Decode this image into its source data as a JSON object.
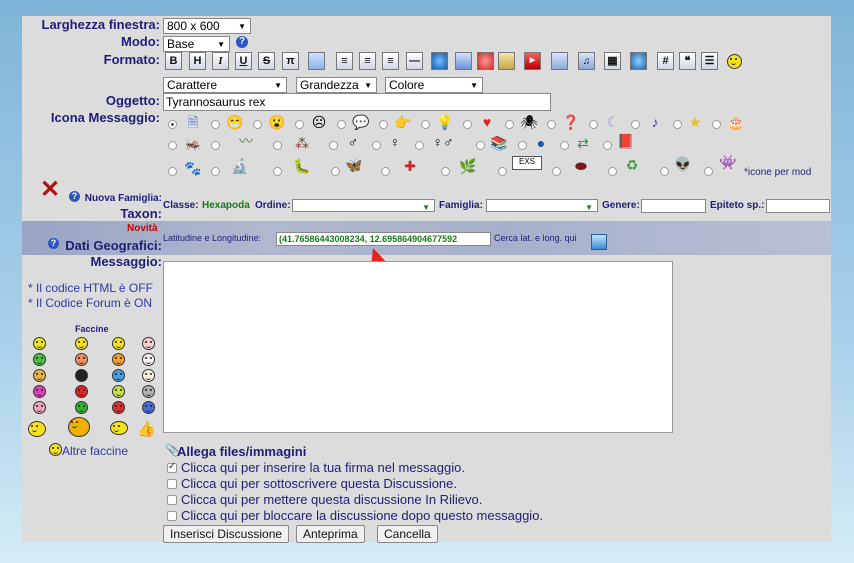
{
  "form": {
    "window_width_label": "Larghezza finestra:",
    "window_width_value": "800 x 600",
    "mode_label": "Modo:",
    "mode_value": "Base",
    "format_label": "Formato:",
    "font_select": "Carattere",
    "size_select": "Grandezza",
    "color_select": "Colore",
    "subject_label": "Oggetto:",
    "subject_value": "Tyrannosaurus rex",
    "icon_label": "Icona Messaggio:",
    "mod_icons_note": "icone per mod",
    "new_family_label": "Nuova Famiglia:",
    "taxon_label": "Taxon:",
    "class_label": "Classe:",
    "class_value": "Hexapoda",
    "order_label": "Ordine:",
    "family_label": "Famiglia:",
    "genus_label": "Genere:",
    "epithet_label": "Epiteto sp.:",
    "news_label": "Novità",
    "geo_label": "Dati Geografici:",
    "latlong_label": "Latitudine e Longitudine:",
    "latlong_value": "(41.76586443008234, 12.695864904677592",
    "latlong_search": "Cerca lat. e long. qui",
    "message_label": "Messaggio:",
    "html_note": "* Il codice HTML è OFF",
    "forum_code_note": "* Il Codice Forum è ON",
    "smilies_title": "Faccine",
    "more_smilies": "Altre faccine",
    "attach_label": "Allega files/immagini",
    "options": [
      {
        "label": "Clicca qui per inserire la tua firma nel messaggio.",
        "checked": true
      },
      {
        "label": "Clicca qui per sottoscrivere questa Discussione.",
        "checked": false
      },
      {
        "label": "Clicca qui per mettere questa discussione In Rilievo.",
        "checked": false
      },
      {
        "label": "Clicca qui per bloccare la discussione dopo questo messaggio.",
        "checked": false
      }
    ],
    "submit_button": "Inserisci Discussione",
    "preview_button": "Anteprima",
    "cancel_button": "Cancella"
  },
  "toolbar": {
    "bold": "B",
    "header": "H",
    "italic": "I",
    "underline": "U",
    "strike": "S",
    "pi": "π",
    "hash": "#",
    "quote": "❝"
  },
  "colors": {
    "label": "#1e1e7a",
    "class_green": "#1a7a1a",
    "novita_red": "#cc0000",
    "arrow_red": "#e82020"
  }
}
